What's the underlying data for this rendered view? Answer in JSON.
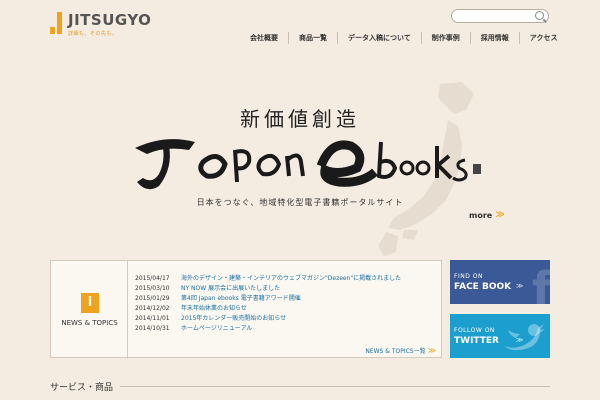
{
  "header": {
    "logo_text": "JITSUGYO",
    "logo_tagline": "詳細も、その先も。",
    "search_placeholder": "",
    "nav": [
      "会社概要",
      "商品一覧",
      "データ入稿について",
      "制作事例",
      "採用情報",
      "アクセス"
    ]
  },
  "hero": {
    "heading": "新価値創造",
    "brand_script": "Japan ebooks",
    "subtitle": "日本をつなぐ、地域特化型電子書籍ポータルサイト",
    "more_label": "more",
    "more_arrow": "≫"
  },
  "news": {
    "icon_glyph": "i",
    "title": "NEWS & TOPICS",
    "items": [
      {
        "date": "2015/04/17",
        "text": "海外のデザイン・建築・インテリアのウェブマガジン\"Dezeen\"に掲載されました"
      },
      {
        "date": "2015/03/10",
        "text": "NY NOW 展示会に出展いたしました"
      },
      {
        "date": "2015/01/29",
        "text": "第4回 Japan ebooks 電子書籍アワード開催"
      },
      {
        "date": "2014/12/02",
        "text": "年末年始休業のお知らせ"
      },
      {
        "date": "2014/11/01",
        "text": "2015年カレンダー販売開始のお知らせ"
      },
      {
        "date": "2014/10/31",
        "text": "ホームページリニューアル"
      }
    ],
    "more_label": "NEWS & TOPICS一覧",
    "more_arrow": "≫"
  },
  "sns": {
    "facebook": {
      "small": "FIND ON",
      "big": "FACE BOOK",
      "arrow": "≫",
      "letter": "f"
    },
    "twitter": {
      "small": "FOLLOW ON",
      "big": "TWITTER",
      "arrow": "≫"
    }
  },
  "services": {
    "heading": "サービス・商品"
  },
  "colors": {
    "accent": "#f0a21e",
    "link": "#1a6fa0",
    "facebook": "#3a5996",
    "twitter": "#1c9fcf",
    "background": "#f4ece0"
  }
}
